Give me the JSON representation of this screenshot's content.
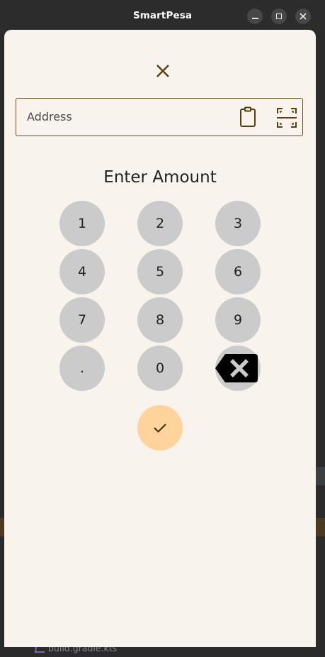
{
  "window": {
    "title": "SmartPesa"
  },
  "background": {
    "file_name": "build.gradle.kts"
  },
  "form": {
    "address_placeholder": "Address",
    "heading": "Enter Amount"
  },
  "keypad": {
    "keys": [
      "1",
      "2",
      "3",
      "4",
      "5",
      "6",
      "7",
      "8",
      "9",
      ".",
      "0"
    ]
  },
  "icons": {
    "close": "close-icon",
    "clipboard": "clipboard-icon",
    "scan": "qr-scan-icon",
    "backspace": "backspace-icon",
    "confirm": "check-icon"
  },
  "colors": {
    "background": "#f8f3ed",
    "key": "#cbcbcb",
    "confirm": "#ffd49c",
    "accent": "#6b4e12"
  }
}
